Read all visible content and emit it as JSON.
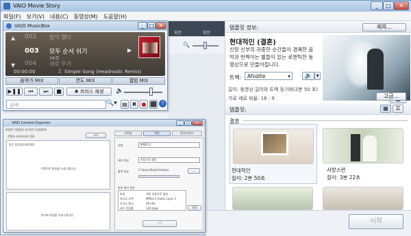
{
  "main": {
    "title": "VAIO Movie Story",
    "menu": [
      "파일(F)",
      "보기(V)",
      "내용(C)",
      "동영상(M)",
      "도움말(H)"
    ],
    "start_label": "시작"
  },
  "template_info": {
    "header": "템플릿 정보:",
    "rename_btn": "제목...",
    "name": "현대적인 (결혼)",
    "description": "신랑 신부의 귀중한 순간들이 경쾌한 음악과 반짝이는 별들이 있는 로맨틱한 동영상으로 만들어집니다.",
    "track_label": "트랙:",
    "track_value": "Afodite",
    "length_text": "길이: 동영상 길이와 트랙 등기화(2분 50 초)",
    "aspect_text": "가로 세로 비율: 16 : 9",
    "advanced_btn": "고급..."
  },
  "templates": {
    "header": "템플릿:",
    "group": "결혼",
    "items": [
      {
        "name": "현대적인",
        "length": "길이: 2분 50초"
      },
      {
        "name": "사랑스런",
        "length": "길이: 3분 22초"
      }
    ]
  },
  "timeline": {
    "tab1": "회전",
    "tab2": "회전"
  },
  "musicbox": {
    "title": "VAIO MusicBox",
    "tracks": [
      {
        "num": "002",
        "title": "밤이 됐다"
      },
      {
        "num": "003",
        "title": "모두 순서 쉬기",
        "sub": "34곡"
      },
      {
        "num": "004",
        "title": "새로 주기"
      }
    ],
    "time": "00:00:00",
    "now_playing": "Simple Song (Headnodic Remix)",
    "mix_buttons": [
      "음악가 MIX",
      "연도 MIX",
      "앨범 MIX"
    ],
    "shuffle_label": "프러스 재생",
    "search_placeholder": "검색"
  },
  "exporter": {
    "title": "VAIO Content Exporter",
    "menu": [
      "파일(F)",
      "편집(E)",
      "보기(V)",
      "도움말(H)"
    ],
    "top_label": "콘텐츠 라이브러리 정보",
    "list_label": "모든 음악(00:00:00)",
    "drop_hint_top": "이쪽으로 파일을 드래그합니다.",
    "bottom_label": "전송 목록",
    "drop_hint_bottom": "여기에 파일을 드래그합니다.",
    "add_btn": "추가",
    "tabs": [
      "자료실",
      "파일",
      "장치/서비스"
    ],
    "fields": [
      {
        "label": "유형",
        "value": "MPEG-2"
      },
      {
        "label": "헤더 파일",
        "value": "자동으로 설정"
      },
      {
        "label": "출력 대상",
        "value": "C:\\Users\\Public\\Videos"
      }
    ],
    "format_label": "파일 형식 설정",
    "settings_rows": [
      {
        "k": "파일",
        "v": "자동 자동으로 생성"
      },
      {
        "k": "비디오 코덱",
        "v": "MPEG-2 Audio Layer 2"
      },
      {
        "k": "오디오 형식",
        "v": "48 kHz"
      },
      {
        "k": "비트 전송률",
        "v": "128 kbps"
      }
    ],
    "change_btn": "변경",
    "export_btn": "시작"
  }
}
